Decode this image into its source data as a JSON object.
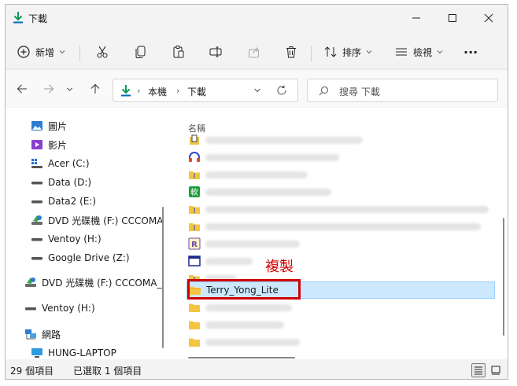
{
  "window": {
    "title": "下載"
  },
  "toolbar": {
    "new_label": "新增",
    "sort_label": "排序",
    "view_label": "檢視",
    "more_label": "···"
  },
  "address": {
    "crumbs": [
      "本機",
      "下載"
    ]
  },
  "search": {
    "placeholder": "搜尋 下載"
  },
  "nav": {
    "items": [
      {
        "label": "圖片",
        "icon": "pictures-icon"
      },
      {
        "label": "影片",
        "icon": "videos-icon"
      },
      {
        "label": "Acer (C:)",
        "icon": "drive-os-icon"
      },
      {
        "label": "Data (D:)",
        "icon": "drive-icon"
      },
      {
        "label": "Data2 (E:)",
        "icon": "drive-icon"
      },
      {
        "label": "DVD 光碟機 (F:) CCCOMA",
        "icon": "dvd-icon"
      },
      {
        "label": "Ventoy (H:)",
        "icon": "drive-icon"
      },
      {
        "label": "Google Drive (Z:)",
        "icon": "drive-icon"
      },
      {
        "label": "DVD 光碟機 (F:) CCCOMA_",
        "icon": "dvd-icon"
      },
      {
        "label": "Ventoy (H:)",
        "icon": "drive-icon"
      },
      {
        "label": "網路",
        "icon": "network-icon"
      },
      {
        "label": "HUNG-LAPTOP",
        "icon": "computer-icon"
      }
    ]
  },
  "files": {
    "column_name": "名稱",
    "selected_name": "Terry_Yong_Lite",
    "annotation": "複製"
  },
  "status": {
    "count": "29 個項目",
    "selection": "已選取 1 個項目"
  },
  "colors": {
    "accent": "#0067c0",
    "selection": "#cce8ff",
    "highlight": "#d10000",
    "folder": "#f5c542"
  }
}
